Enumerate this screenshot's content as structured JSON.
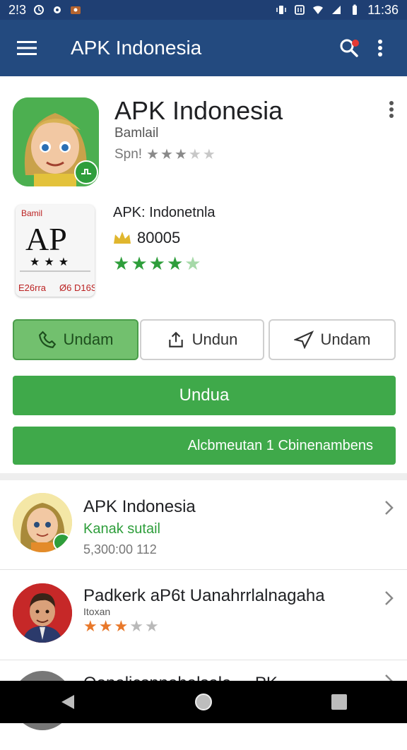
{
  "status": {
    "left_text": "2!3",
    "time": "11:36",
    "icons": [
      "notification-icon",
      "clock-icon",
      "settings-icon",
      "photo-icon",
      "vibrate-icon",
      "nfc-icon",
      "wifi-icon",
      "signal-icon",
      "battery-icon"
    ]
  },
  "appbar": {
    "title": "APK Indonesia",
    "menu_icon": "hamburger-icon",
    "search_icon": "search-icon",
    "more_icon": "more-vert-icon"
  },
  "hero": {
    "title": "APK Indonesia",
    "subtitle": "Bamlail",
    "rating_prefix": "Spn!",
    "stars_filled": 3,
    "stars_total": 5
  },
  "app2": {
    "title": "APK: Indonetnla",
    "downloads": "80005",
    "stars_filled": 4,
    "stars_total": 5,
    "icon_top_label": "Bamil",
    "icon_logo": "AP",
    "icon_bottom_left": "E26rra",
    "icon_bottom_right": "Ø6 D16S"
  },
  "segments": [
    {
      "label": "Undam",
      "icon": "phone-icon",
      "active": true
    },
    {
      "label": "Undun",
      "icon": "share-icon",
      "active": false
    },
    {
      "label": "Undam",
      "icon": "send-icon",
      "active": false
    }
  ],
  "buttons": {
    "primary": "Undua",
    "secondary": "Alcbmeutan 1 Cbinenambens"
  },
  "list": [
    {
      "title": "APK Indonesia",
      "subtitle": "Kanak sutail",
      "meta": "5,300:00 112",
      "avatar": "girl"
    },
    {
      "title": "Padkerk aP6t Uanahrrlalnagaha",
      "subtitle": "Itoxan",
      "meta": "",
      "stars_filled": 3,
      "stars_total": 5,
      "avatar": "man"
    },
    {
      "title": "Oonalicsnnahalsala ... PK",
      "subtitle": "",
      "meta": "",
      "avatar": "gray"
    }
  ],
  "colors": {
    "status_bar": "#1f3f73",
    "app_bar": "#234a7f",
    "accent_green": "#3fa94a",
    "star_green": "#2e9e3b",
    "star_orange": "#e8782a"
  },
  "navbar": {
    "back": "back-icon",
    "home": "home-icon",
    "recents": "recents-icon"
  }
}
